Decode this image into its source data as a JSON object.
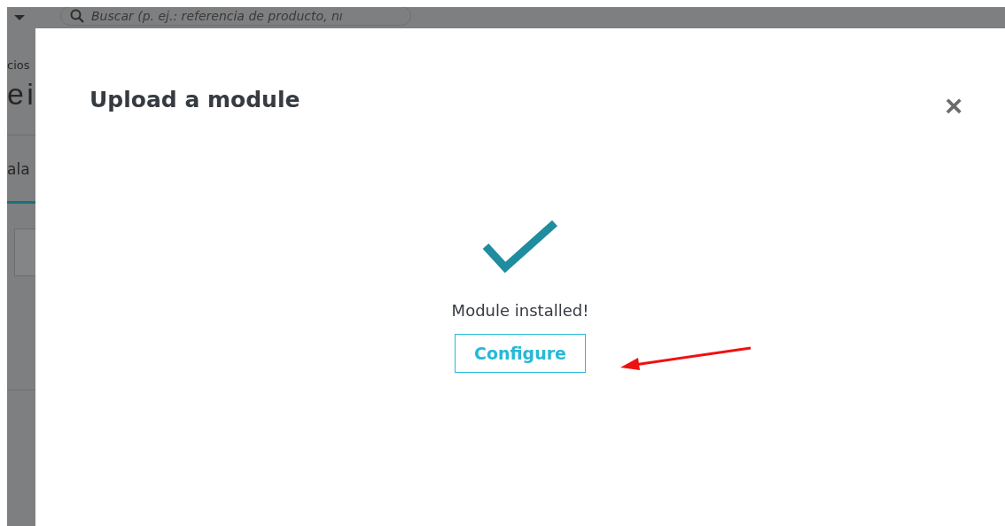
{
  "background_page": {
    "search": {
      "placeholder": "Buscar (p. ej.: referencia de producto, nı"
    },
    "breadcrumb": "cios",
    "page_title": "e i",
    "tab": {
      "label": "ala",
      "selected": true
    }
  },
  "modal": {
    "title": "Upload a module",
    "close": "×",
    "message": "Module installed!",
    "button": "Configure"
  }
}
